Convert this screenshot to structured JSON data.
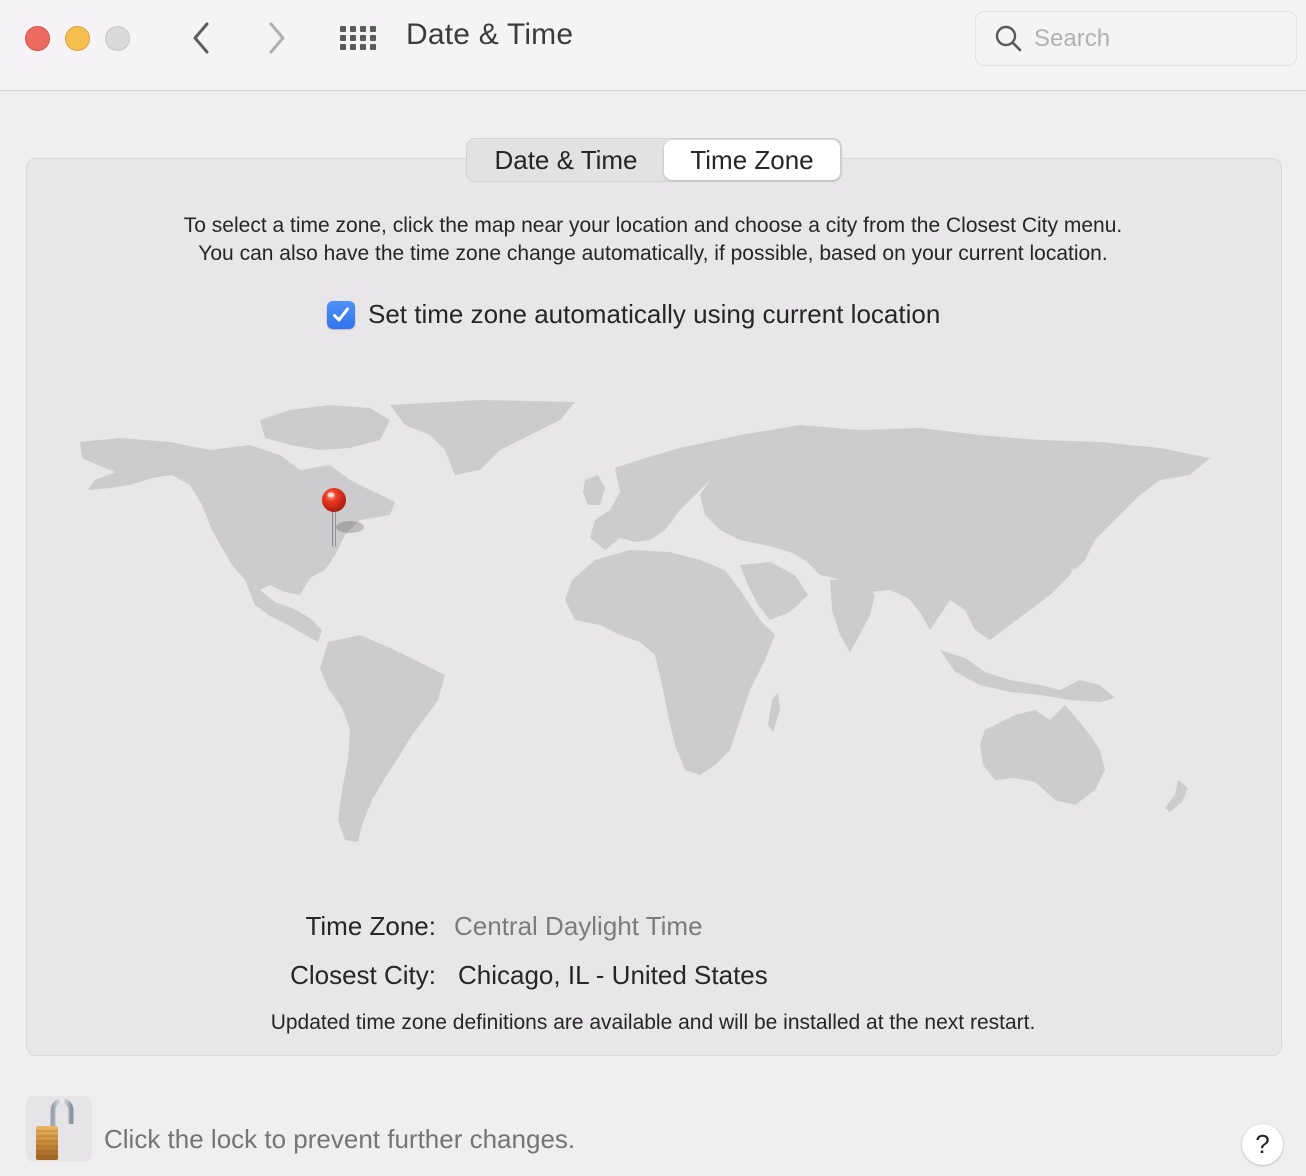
{
  "window": {
    "title": "Date & Time",
    "controls": [
      "close",
      "minimize",
      "zoom"
    ],
    "nav": {
      "back_icon": "chevron-left-icon",
      "forward_icon": "chevron-right-icon",
      "show_all_icon": "grid-icon"
    }
  },
  "search": {
    "placeholder": "Search",
    "value": ""
  },
  "tabs": [
    {
      "label": "Date & Time",
      "active": false
    },
    {
      "label": "Time Zone",
      "active": true
    }
  ],
  "description": {
    "line1": "To select a time zone, click the map near your location and choose a city from the Closest City menu.",
    "line2": "You can also have the time zone change automatically, if possible, based on your current location."
  },
  "auto_timezone": {
    "label": "Set time zone automatically using current location",
    "checked": true
  },
  "map": {
    "pin_location": "Chicago, IL",
    "pin_icon": "map-pin-icon"
  },
  "time_zone": {
    "label": "Time Zone:",
    "value": "Central Daylight Time"
  },
  "closest_city": {
    "label": "Closest City:",
    "value": "Chicago, IL - United States"
  },
  "update_note": "Updated time zone definitions are available and will be installed at the next restart.",
  "lock": {
    "text": "Click the lock to prevent further changes.",
    "state": "unlocked"
  },
  "help": {
    "label": "?"
  },
  "colors": {
    "accent": "#3b82f6",
    "close": "#ec6a5f",
    "minimize": "#f4bf4f",
    "map_land": "#cccbce",
    "map_ocean": "#e8e6e8"
  }
}
